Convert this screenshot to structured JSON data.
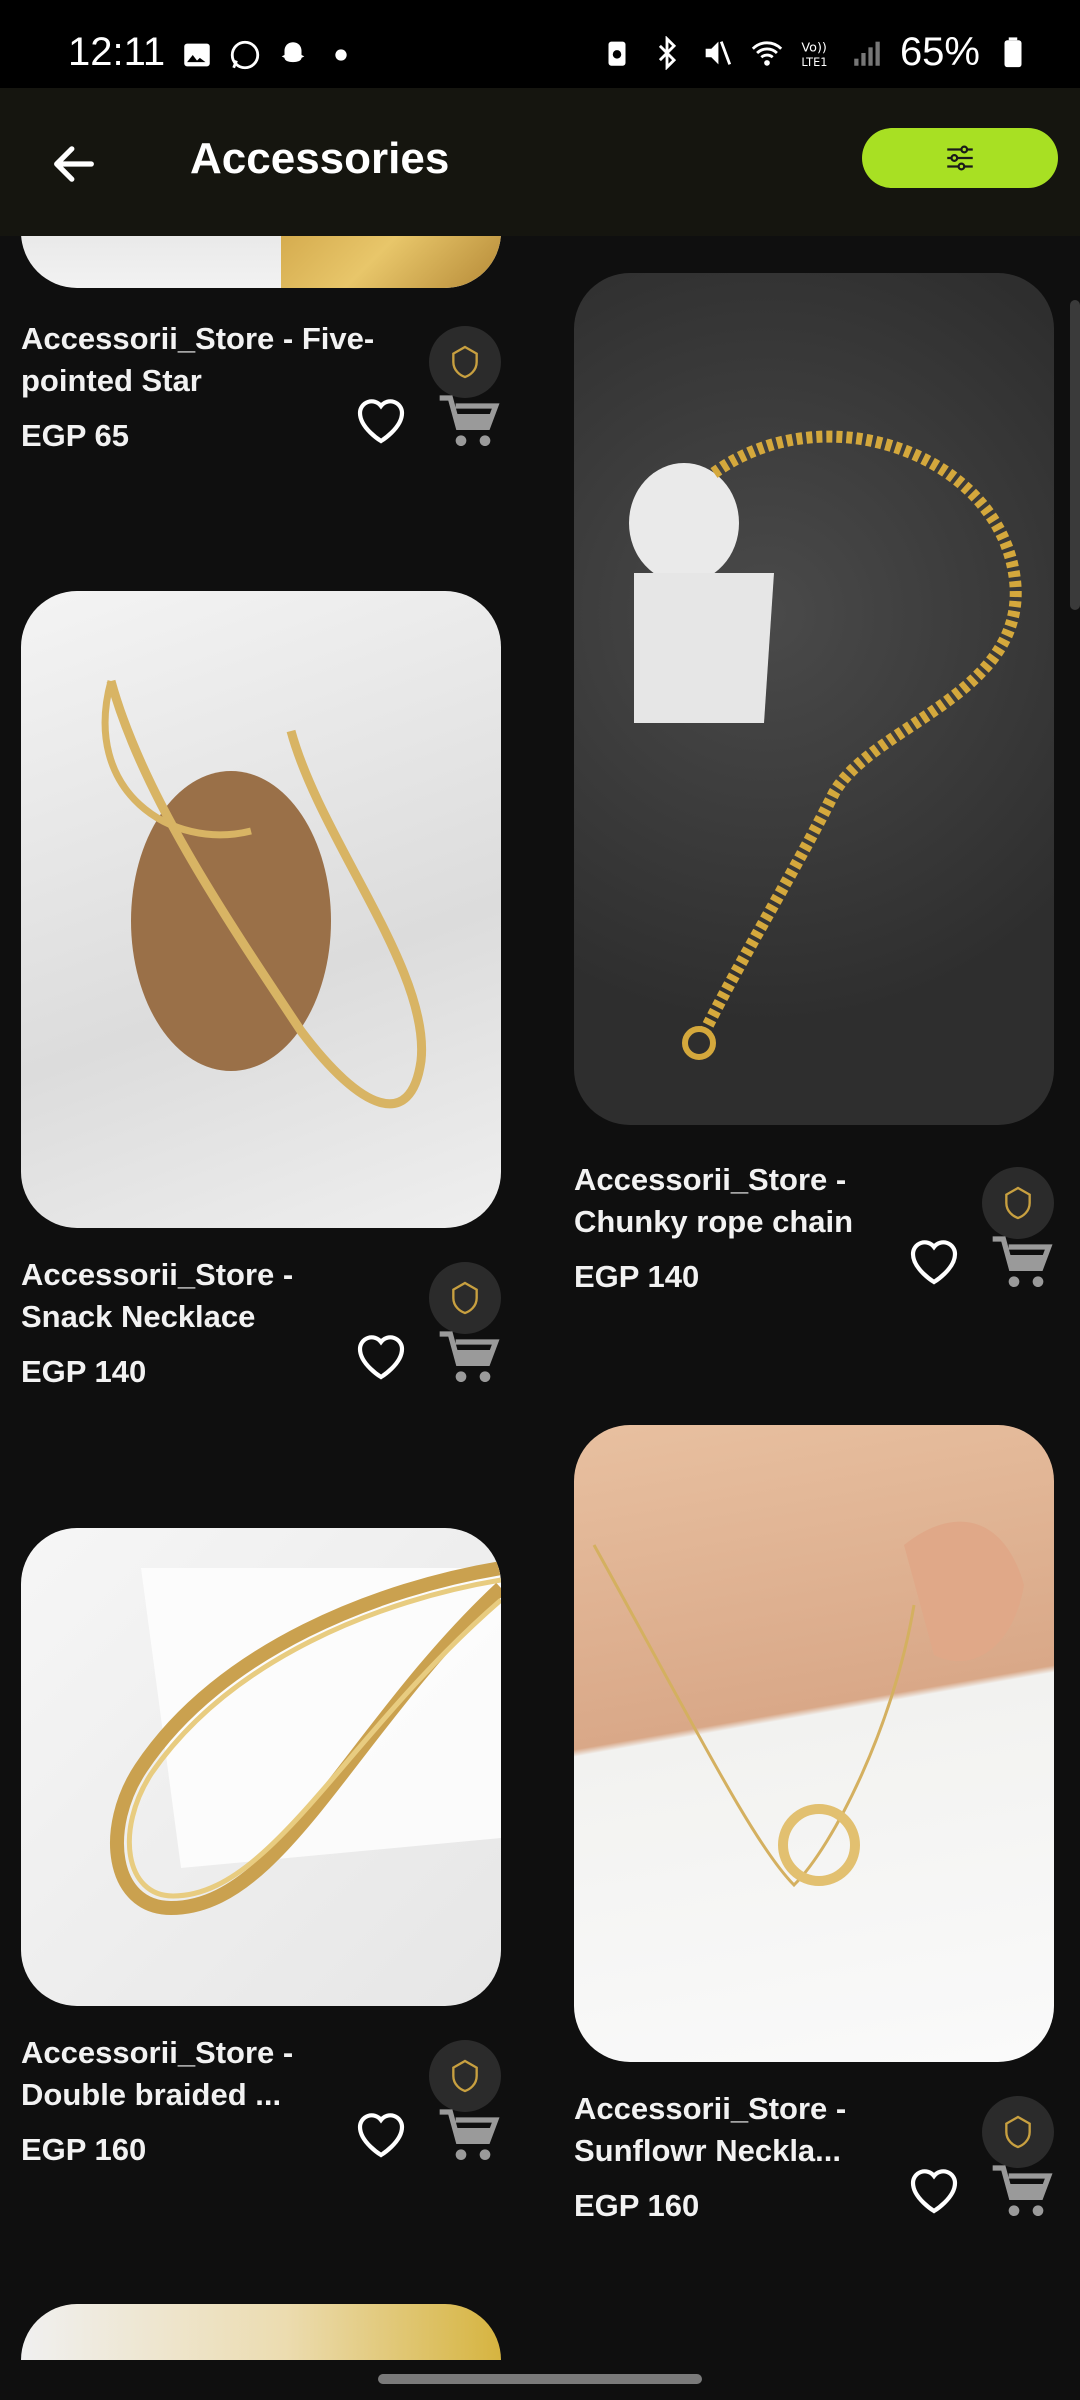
{
  "status_bar": {
    "time": "12:11",
    "battery": "65%",
    "left_icons": [
      "gallery-icon",
      "whatsapp-icon",
      "snapchat-icon",
      "dot-icon"
    ],
    "right_icons": [
      "battery-saver-icon",
      "bluetooth-icon",
      "mute-icon",
      "wifi-icon",
      "volte-icon",
      "signal-icon",
      "battery-icon"
    ]
  },
  "header": {
    "title": "Accessories",
    "back_icon": "back-arrow-icon",
    "filter_icon": "sliders-icon",
    "accent": "#a8e023"
  },
  "products": [
    {
      "name": "Accessorii_Store - Five-pointed Star",
      "price": "EGP 65"
    },
    {
      "name": "Accessorii_Store - Chunky rope chain",
      "price": "EGP 140"
    },
    {
      "name": "Accessorii_Store - Snack Necklace",
      "price": "EGP 140"
    },
    {
      "name": "Accessorii_Store - Sunflowr Neckla...",
      "price": "EGP 160"
    },
    {
      "name": "Accessorii_Store - Double braided ...",
      "price": "EGP 160"
    }
  ]
}
